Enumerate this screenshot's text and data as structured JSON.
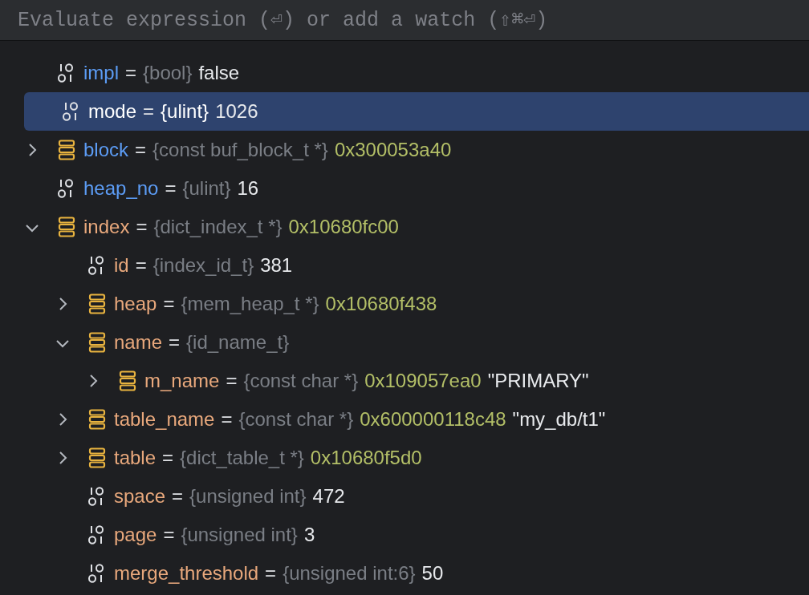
{
  "evaluate_field": {
    "placeholder": "Evaluate expression (⏎) or add a watch (⇧⌘⏎)"
  },
  "variables": [
    {
      "kind": "primitive",
      "name": "impl",
      "color": "#5c9cf5",
      "separator": "=",
      "type": "{bool}",
      "value": "false",
      "selected": false
    },
    {
      "kind": "primitive",
      "name": "mode",
      "color": "#ffffff",
      "separator": "=",
      "type": "{ulint}",
      "value": "1026",
      "selected": true
    },
    {
      "kind": "struct",
      "name": "block",
      "color": "#5c9cf5",
      "separator": "=",
      "type": "{const buf_block_t *}",
      "address": "0x300053a40",
      "selected": false,
      "expanded": false
    },
    {
      "kind": "primitive",
      "name": "heap_no",
      "color": "#5c9cf5",
      "separator": "=",
      "type": "{ulint}",
      "value": "16",
      "selected": false
    },
    {
      "kind": "struct",
      "name": "index",
      "color": "#e8a87c",
      "separator": "=",
      "type": "{dict_index_t *}",
      "address": "0x10680fc00",
      "selected": false,
      "expanded": true,
      "children": [
        {
          "kind": "primitive",
          "name": "id",
          "color": "#e8a87c",
          "separator": "=",
          "type": "{index_id_t}",
          "value": "381",
          "selected": false
        },
        {
          "kind": "struct",
          "name": "heap",
          "color": "#e8a87c",
          "separator": "=",
          "type": "{mem_heap_t *}",
          "address": "0x10680f438",
          "selected": false,
          "expanded": false
        },
        {
          "kind": "struct",
          "name": "name",
          "color": "#e8a87c",
          "separator": "=",
          "type": "{id_name_t}",
          "selected": false,
          "expanded": true,
          "children": [
            {
              "kind": "struct",
              "name": "m_name",
              "color": "#e8a87c",
              "separator": "=",
              "type": "{const char *}",
              "address": "0x109057ea0",
              "value": "\"PRIMARY\"",
              "selected": false,
              "expanded": false
            }
          ]
        },
        {
          "kind": "struct",
          "name": "table_name",
          "color": "#e8a87c",
          "separator": "=",
          "type": "{const char *}",
          "address": "0x600000118c48",
          "value": "\"my_db/t1\"",
          "selected": false,
          "expanded": false
        },
        {
          "kind": "struct",
          "name": "table",
          "color": "#e8a87c",
          "separator": "=",
          "type": "{dict_table_t *}",
          "address": "0x10680f5d0",
          "selected": false,
          "expanded": false
        },
        {
          "kind": "primitive",
          "name": "space",
          "color": "#e8a87c",
          "separator": "=",
          "type": "{unsigned int}",
          "value": "472",
          "selected": false
        },
        {
          "kind": "primitive",
          "name": "page",
          "color": "#e8a87c",
          "separator": "=",
          "type": "{unsigned int}",
          "value": "3",
          "selected": false
        },
        {
          "kind": "primitive",
          "name": "merge_threshold",
          "color": "#e8a87c",
          "separator": "=",
          "type": "{unsigned int:6}",
          "value": "50",
          "selected": false
        }
      ]
    }
  ]
}
